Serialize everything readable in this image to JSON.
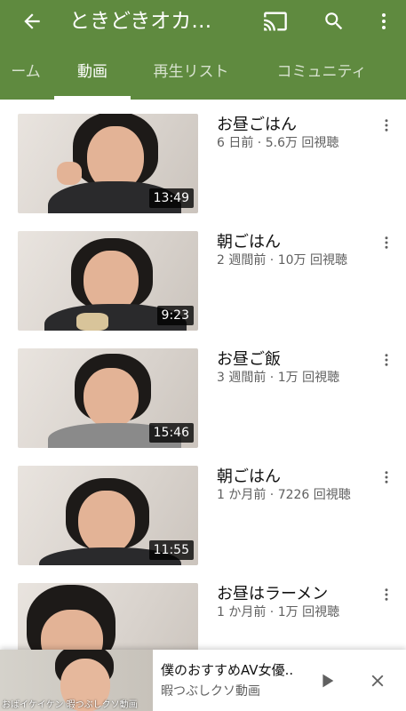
{
  "header": {
    "title": "ときどきオカ…",
    "icons": {
      "back": "arrow-back-icon",
      "cast": "cast-icon",
      "search": "search-icon",
      "more": "more-vert-icon"
    },
    "accent_color": "#5f8a3f"
  },
  "tabs": [
    {
      "label": "ーム",
      "active": false
    },
    {
      "label": "動画",
      "active": true
    },
    {
      "label": "再生リスト",
      "active": false
    },
    {
      "label": "コミュニティ",
      "active": false
    }
  ],
  "videos": [
    {
      "title": "お昼ごはん",
      "meta": "6 日前 · 5.6万 回視聴",
      "duration": "13:49"
    },
    {
      "title": "朝ごはん",
      "meta": "2 週間前 · 10万 回視聴",
      "duration": "9:23"
    },
    {
      "title": "お昼ご飯",
      "meta": "3 週間前 · 1万 回視聴",
      "duration": "15:46"
    },
    {
      "title": "朝ごはん",
      "meta": "1 か月前 · 7226 回視聴",
      "duration": "11:55"
    },
    {
      "title": "お昼はラーメン",
      "meta": "1 か月前 · 1万 回視聴",
      "duration": ""
    }
  ],
  "mini_player": {
    "title": "僕のおすすめAV女優..",
    "channel": "暇つぶしクソ動画",
    "caption": "おばイケイケン 暇つぶしクソ動画",
    "icons": {
      "play": "play-icon",
      "close": "close-icon"
    }
  }
}
